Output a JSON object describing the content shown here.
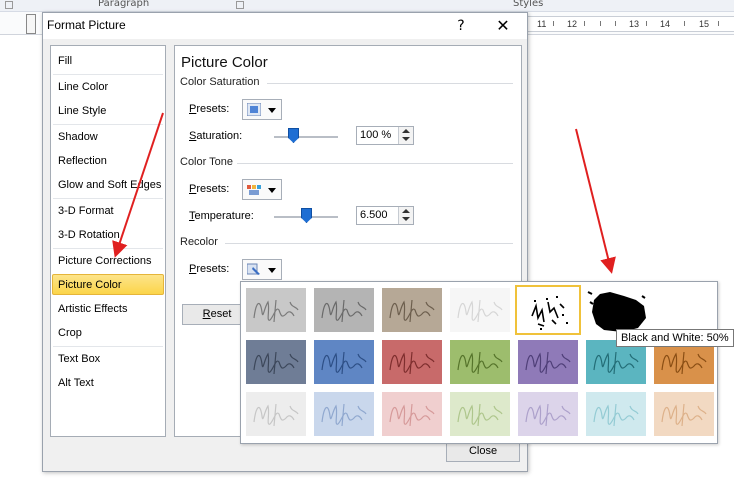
{
  "ribbon": {
    "paragraph_label": "Paragraph",
    "styles_label": "Styles"
  },
  "ruler": {
    "numbers": [
      "11",
      "12",
      "13",
      "14",
      "15"
    ]
  },
  "dialog": {
    "title": "Format Picture",
    "help": "?",
    "close_glyph": "✕",
    "close_button": "Close"
  },
  "nav": {
    "items": [
      {
        "label": "Fill"
      },
      {
        "label": "Line Color"
      },
      {
        "label": "Line Style"
      },
      {
        "label": "Shadow"
      },
      {
        "label": "Reflection"
      },
      {
        "label": "Glow and Soft Edges"
      },
      {
        "label": "3-D Format"
      },
      {
        "label": "3-D Rotation"
      },
      {
        "label": "Picture Corrections"
      },
      {
        "label": "Picture Color",
        "selected": true
      },
      {
        "label": "Artistic Effects"
      },
      {
        "label": "Crop"
      },
      {
        "label": "Text Box"
      },
      {
        "label": "Alt Text"
      }
    ]
  },
  "panel": {
    "heading": "Picture Color",
    "saturation": {
      "section": "Color Saturation",
      "presets_label": "Presets:",
      "slider_label": "Saturation:",
      "value": "100 %",
      "level": 1.0
    },
    "tone": {
      "section": "Color Tone",
      "presets_label": "Presets:",
      "slider_label": "Temperature:",
      "value": "6.500",
      "level": 0.5
    },
    "recolor": {
      "section": "Recolor",
      "presets_label": "Presets:"
    },
    "reset": "Reset"
  },
  "gallery": {
    "tooltip": "Black and White: 50%",
    "rows": [
      [
        {
          "bg": "#c8c8c8",
          "ink": "#7a7a7a"
        },
        {
          "bg": "#b4b4b4",
          "ink": "#6a6a6a"
        },
        {
          "bg": "#b6a896",
          "ink": "#6d5f4e"
        },
        {
          "bg": "#f6f6f6",
          "ink": "#d6d6d6"
        },
        {
          "bg": "#ffffff",
          "ink": "#000000",
          "style": "bw50",
          "selected": true
        },
        {
          "bg": "#ffffff",
          "ink": "#000000",
          "style": "bw75"
        }
      ],
      [
        {
          "bg": "#6f7d96",
          "ink": "#3c475a"
        },
        {
          "bg": "#5f86c4",
          "ink": "#2d4f86"
        },
        {
          "bg": "#c86a6a",
          "ink": "#7e2e2e"
        },
        {
          "bg": "#9dbd6d",
          "ink": "#56742b"
        },
        {
          "bg": "#8f7ab8",
          "ink": "#4f3f78"
        },
        {
          "bg": "#5bb5c0",
          "ink": "#236d76"
        },
        {
          "bg": "#d9914a",
          "ink": "#8a4e14"
        }
      ],
      [
        {
          "bg": "#ededed",
          "ink": "#c6c6c6"
        },
        {
          "bg": "#c9d7ec",
          "ink": "#90a8cf"
        },
        {
          "bg": "#f0cfcf",
          "ink": "#d69a9a"
        },
        {
          "bg": "#dde9cb",
          "ink": "#aec68c"
        },
        {
          "bg": "#dcd4ea",
          "ink": "#ada1cb"
        },
        {
          "bg": "#cfe9ee",
          "ink": "#94cbd4"
        },
        {
          "bg": "#f2d9c2",
          "ink": "#ddb18a"
        }
      ]
    ]
  },
  "annotations": {
    "arrow_color": "#e02020"
  }
}
